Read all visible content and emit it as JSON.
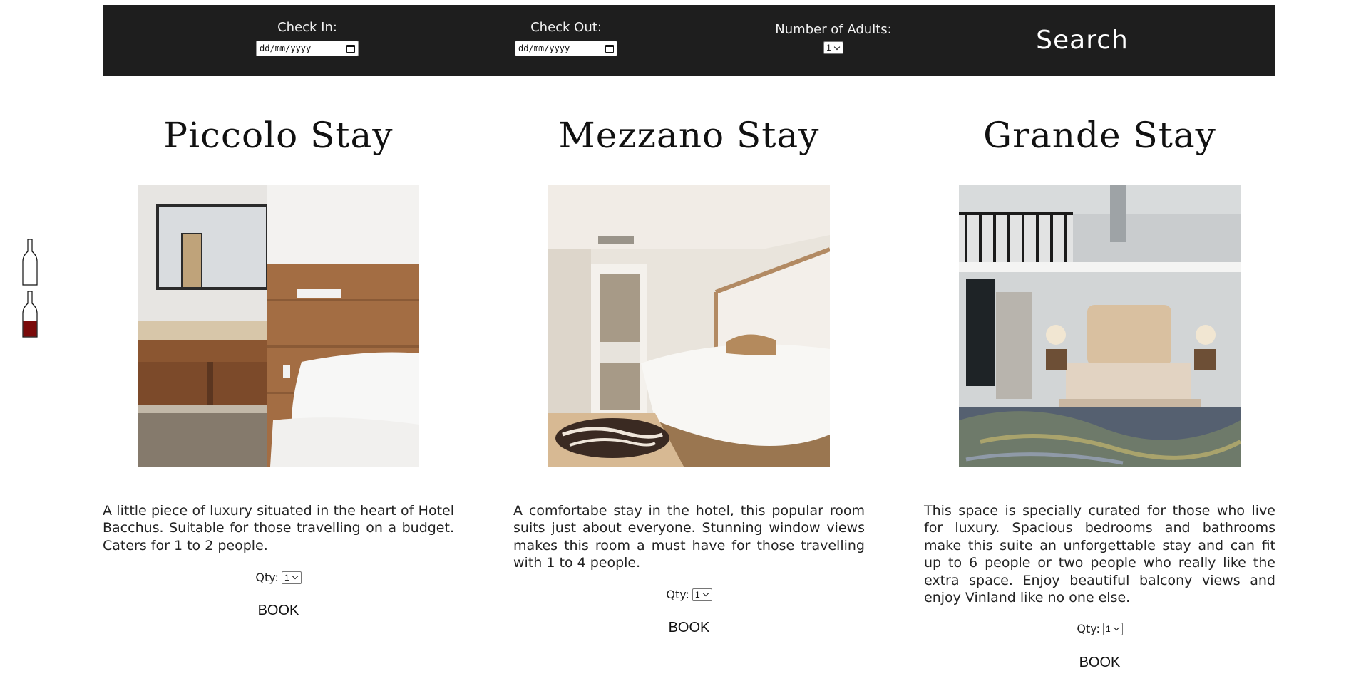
{
  "search": {
    "checkin_label": "Check In:",
    "checkin_value": "dd/mm/yyyy",
    "checkout_label": "Check Out:",
    "checkout_value": "dd/mm/yyyy",
    "adults_label": "Number of Adults:",
    "adults_value": "1",
    "search_label": "Search"
  },
  "side": {
    "bottle_empty_icon": "wine-bottle-empty-icon",
    "bottle_filled_icon": "wine-bottle-filled-icon",
    "fill_color": "#7a0a0a"
  },
  "rooms": [
    {
      "title": "Piccolo Stay",
      "description": "A little piece of luxury situated in the heart of Hotel Bacchus. Suitable for those travelling on a budget. Caters for 1 to 2 people.",
      "qty_label": "Qty:",
      "qty_value": "1",
      "book_label": "BOOK"
    },
    {
      "title": "Mezzano Stay",
      "description": "A comfortabe stay in the hotel, this popular room suits just about everyone. Stunning window views makes this room a must have for those travelling with 1 to 4 people.",
      "qty_label": "Qty:",
      "qty_value": "1",
      "book_label": "BOOK"
    },
    {
      "title": "Grande Stay",
      "description": "This space is specially curated for those who live for luxury. Spacious bedrooms and bathrooms make this suite an unforgettable stay and can fit up to 6 people or two people who really like the extra space. Enjoy beautiful balcony views and enjoy Vinland like no one else.",
      "qty_label": "Qty:",
      "qty_value": "1",
      "book_label": "BOOK"
    }
  ],
  "colors": {
    "bar_background": "#1e1e1e",
    "bar_text": "#ffffff",
    "accent_wine": "#7a0a0a"
  }
}
